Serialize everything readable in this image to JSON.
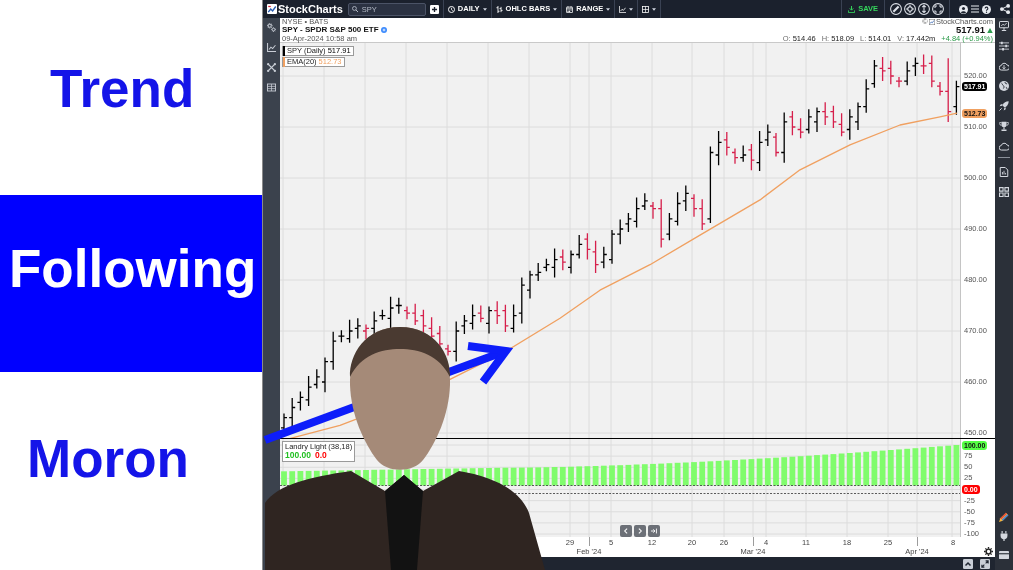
{
  "slide": {
    "lines": [
      {
        "text": "Trend",
        "highlighted": false
      },
      {
        "text": "Following",
        "highlighted": true
      },
      {
        "text": "Moron",
        "highlighted": false
      }
    ]
  },
  "navbar": {
    "logo": "StockCharts",
    "search": {
      "placeholder": "SPY"
    },
    "dropdowns": [
      {
        "label": "DAILY"
      },
      {
        "label": "OHLC BARS"
      },
      {
        "label": "RANGE"
      }
    ],
    "save": "SAVE"
  },
  "header": {
    "exchange": "NYSE • BATS",
    "symbol": "SPY - SPDR S&P 500 ETF",
    "timestamp": "09-Apr-2024 10:58 am",
    "copyright": "©",
    "source": "StockCharts.com",
    "price": "517.91",
    "rising": true,
    "quote": [
      {
        "label": "O:",
        "value": "514.46"
      },
      {
        "label": "H:",
        "value": "518.09"
      },
      {
        "label": "L:",
        "value": "514.01"
      },
      {
        "label": "V:",
        "value": "17.442m"
      }
    ],
    "change": "+4.84 (+0.94%)"
  },
  "price_pane": {
    "legend": [
      {
        "label": "SPY (Daily)",
        "value": "517.91",
        "color": "#000000"
      },
      {
        "label": "EMA(20)",
        "value": "512.73",
        "color": "#f0a060"
      }
    ],
    "axis": [
      "520.00",
      "510.00",
      "500.00",
      "490.00",
      "480.00",
      "470.00",
      "460.00",
      "450.00"
    ],
    "tags": [
      {
        "text": "517.91",
        "color": "#000000"
      },
      {
        "text": "512.73",
        "color": "#f0a060"
      }
    ]
  },
  "indicator_pane": {
    "name": "Landry Light (38,18)",
    "readings": [
      {
        "text": "100.00",
        "color": "#22c022"
      },
      {
        "text": "0.0",
        "color": "#ff0000"
      }
    ],
    "axis": [
      {
        "kind": "tag",
        "text": "100.00",
        "color": "#55ff44"
      },
      {
        "kind": "tick",
        "text": "75"
      },
      {
        "kind": "tick",
        "text": "50"
      },
      {
        "kind": "tick",
        "text": "25"
      },
      {
        "kind": "tag",
        "text": "0.00",
        "color": "#ff0000"
      },
      {
        "kind": "tick",
        "text": "-25"
      },
      {
        "kind": "tick",
        "text": "-50"
      },
      {
        "kind": "tick",
        "text": "-75"
      },
      {
        "kind": "tick",
        "text": "-100"
      }
    ]
  },
  "x_axis": {
    "days": [
      "29",
      "5",
      "12",
      "20",
      "26",
      "4",
      "11",
      "18",
      "25",
      "8"
    ],
    "months": [
      "Feb '24",
      "Mar '24",
      "Apr '24"
    ]
  }
}
